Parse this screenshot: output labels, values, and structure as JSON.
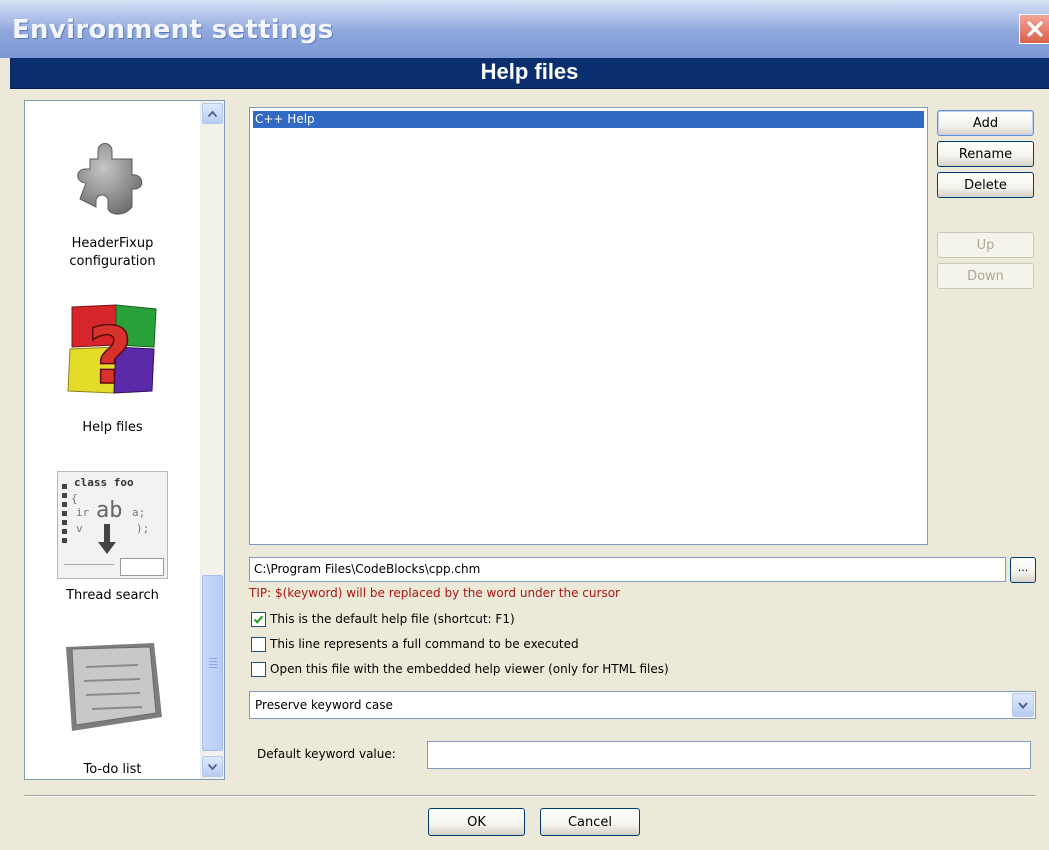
{
  "window": {
    "title": "Environment settings",
    "close_glyph": "✕"
  },
  "header": {
    "title": "Help files"
  },
  "sidebar": {
    "items": [
      {
        "label_line1": "HeaderFixup",
        "label_line2": "configuration",
        "icon": "puzzle-piece-icon"
      },
      {
        "label_line1": "Help files",
        "label_line2": "",
        "icon": "help-cubes-icon"
      },
      {
        "label_line1": "Thread search",
        "label_line2": "",
        "icon": "thread-search-icon"
      },
      {
        "label_line1": "To-do list",
        "label_line2": "",
        "icon": "todo-note-icon"
      }
    ],
    "thread_icon_text": {
      "line1": "class foo",
      "line2": "ab"
    }
  },
  "help_list": {
    "items": [
      "C++ Help"
    ],
    "selected": "C++ Help"
  },
  "buttons": {
    "add": "Add",
    "rename": "Rename",
    "delete": "Delete",
    "up": "Up",
    "down": "Down",
    "browse": "...",
    "ok": "OK",
    "cancel": "Cancel"
  },
  "path": {
    "value": "C:\\Program Files\\CodeBlocks\\cpp.chm"
  },
  "tip": "TIP: $(keyword) will be replaced by the word under the cursor",
  "checkboxes": [
    {
      "label": "This is the default help file (shortcut: F1)",
      "checked": true
    },
    {
      "label": "This line represents a full command to be executed",
      "checked": false
    },
    {
      "label": "Open this file with the embedded help viewer (only for HTML files)",
      "checked": false
    }
  ],
  "keyword_case": {
    "selected": "Preserve keyword case"
  },
  "default_keyword": {
    "label": "Default keyword value:",
    "value": ""
  },
  "colors": {
    "accent": "#0b2f6e",
    "selection": "#316ac5",
    "tip": "#a81814"
  }
}
